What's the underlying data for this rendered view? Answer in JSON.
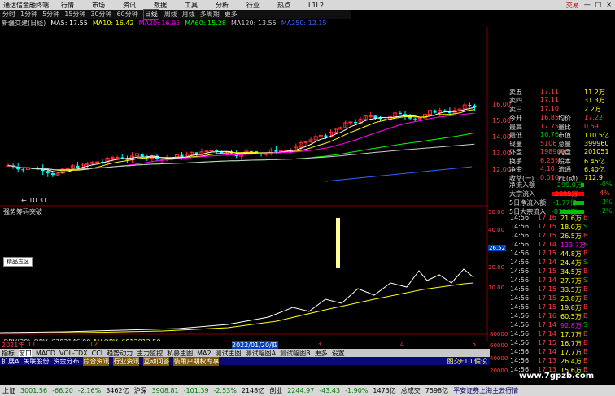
{
  "menu": {
    "app_title": "通达信金融终端",
    "items": [
      "行情",
      "市场",
      "资讯",
      "数据",
      "工具",
      "分析",
      "行业",
      "热点",
      "L1L2"
    ],
    "right": [
      "交易",
      "—",
      "□",
      "×"
    ]
  },
  "periods": {
    "items": [
      "分时",
      "1分钟",
      "5分钟",
      "15分钟",
      "30分钟",
      "60分钟",
      "日线",
      "周线",
      "月线",
      "多周期",
      "更多"
    ],
    "active_index": 6
  },
  "ma_line": {
    "title": "新疆交建(日线)",
    "items": [
      {
        "text": "MA5: 17.55",
        "color": "#ffffff"
      },
      {
        "text": "MA10: 16.42",
        "color": "#ffff00"
      },
      {
        "text": "MA20: 16.95",
        "color": "#ff00ff"
      },
      {
        "text": "MA60: 15.28",
        "color": "#00ff00"
      },
      {
        "text": "MA120: 13.55",
        "color": "#cccccc"
      },
      {
        "text": "MA250: 12.15",
        "color": "#3366ff"
      }
    ]
  },
  "price_axis": [
    "16.00",
    "15.00",
    "14.00",
    "13.00",
    "12.00"
  ],
  "low_label": "10.31",
  "indicator1": {
    "title": "强势筹码突破",
    "box_label": "精品五区",
    "axis": [
      "50.00",
      "40.00",
      "26.52",
      "20.00",
      "10.00"
    ]
  },
  "indicator2": {
    "title": "OBV(30)",
    "obv": "OBV: 6782146.00",
    "maobv": "MAOBV: 6812012.50",
    "axis": [
      "80000",
      "60000",
      "40000",
      "20000"
    ]
  },
  "date_axis": {
    "labels": [
      "2021年",
      "11",
      "12",
      "2022/01/20/四",
      "3",
      "4",
      "5"
    ]
  },
  "order_book": [
    {
      "label": "卖四",
      "price": "17.11",
      "vol": "31.3万"
    },
    {
      "label": "卖三",
      "price": "17.10",
      "vol": "2.2万"
    }
  ],
  "order_book_top": {
    "label": "卖五",
    "price": "17.11",
    "vol": "11.2万"
  },
  "stats": [
    {
      "l1": "今开",
      "v1": "16.85",
      "l2": "均价",
      "v2": "17.22"
    },
    {
      "l1": "最高",
      "v1": "17.75",
      "l2": "量比",
      "v2": "0.59"
    },
    {
      "l1": "最低",
      "v1": "16.76",
      "l2": "市值",
      "v2": "110.5亿"
    },
    {
      "l1": "现量",
      "v1": "5106",
      "l2": "总量",
      "v2": "399960"
    },
    {
      "l1": "外盘",
      "v1": "198909",
      "l2": "内盘",
      "v2": "201051"
    },
    {
      "l1": "换手",
      "v1": "6.25%",
      "l2": "股本",
      "v2": "6.45亿"
    },
    {
      "l1": "净资",
      "v1": "4.10",
      "l2": "流通",
      "v2": "6.40亿"
    },
    {
      "l1": "收益(一)",
      "v1": "0.010",
      "l2": "PE(动)",
      "v2": "712.9"
    }
  ],
  "fund_flow": [
    {
      "label": "净流入额",
      "value": "-299.0万",
      "pct": "-0%"
    },
    {
      "label": "大宗流入",
      "value": "2695万",
      "pct": "4%"
    },
    {
      "label": "5日净流入额",
      "value": "-1.77亿",
      "pct": "-3%"
    },
    {
      "label": "5日大宗流入",
      "value": "-8326万",
      "pct": "-2%"
    }
  ],
  "ticks": [
    {
      "t": "14:56",
      "p": "17.16",
      "v": "21.6",
      "d": "B"
    },
    {
      "t": "14:56",
      "p": "17.15",
      "v": "18.0",
      "d": "S"
    },
    {
      "t": "14:56",
      "p": "17.15",
      "v": "26.5",
      "d": "B"
    },
    {
      "t": "14:56",
      "p": "17.14",
      "v": "133.7",
      "d": "S"
    },
    {
      "t": "14:56",
      "p": "17.15",
      "v": "44.8",
      "d": "B"
    },
    {
      "t": "14:56",
      "p": "17.14",
      "v": "24.4",
      "d": "S"
    },
    {
      "t": "14:56",
      "p": "17.15",
      "v": "34.5",
      "d": "B"
    },
    {
      "t": "14:56",
      "p": "17.14",
      "v": "27.7",
      "d": "S"
    },
    {
      "t": "14:56",
      "p": "17.15",
      "v": "33.5",
      "d": "B"
    },
    {
      "t": "14:56",
      "p": "17.15",
      "v": "23.8",
      "d": "B"
    },
    {
      "t": "14:56",
      "p": "17.15",
      "v": "19.8",
      "d": "B"
    },
    {
      "t": "14:56",
      "p": "17.16",
      "v": "60.5",
      "d": "B"
    },
    {
      "t": "14:56",
      "p": "17.14",
      "v": "92.8",
      "d": "S"
    },
    {
      "t": "14:56",
      "p": "17.14",
      "v": "17.7",
      "d": "B"
    },
    {
      "t": "14:56",
      "p": "17.15",
      "v": "16.7",
      "d": "B"
    },
    {
      "t": "14:56",
      "p": "17.14",
      "v": "17.7",
      "d": "B"
    },
    {
      "t": "14:56",
      "p": "17.13",
      "v": "26.4",
      "d": "B"
    },
    {
      "t": "14:56",
      "p": "17.13",
      "v": "15.6",
      "d": "B"
    }
  ],
  "bottom_tabs": [
    "指标",
    "窗口",
    "MACD",
    "VOL-TDX",
    "CCI",
    "趋势动力",
    "主力监控",
    "私募主图",
    "MA2",
    "测试主图",
    "测试幅图A",
    "测试幅图B",
    "更多",
    "设置"
  ],
  "bottom_tabs2": [
    "扩展A",
    "关联股份",
    "资金分布",
    "综合资讯",
    "行业资讯",
    "互动问答",
    "装用户期权专享"
  ],
  "bottom_tabs2_right": "图交F10 假设",
  "status": [
    {
      "name": "上证",
      "value": "3001.56",
      "chg": "-66.20",
      "pct": "-2.16%",
      "amt": "3462亿"
    },
    {
      "name": "沪深",
      "value": "3908.81",
      "chg": "-101.39",
      "pct": "-2.53%",
      "amt": "2148亿"
    },
    {
      "name": "创业",
      "value": "2244.97",
      "chg": "-43.43",
      "pct": "-1.90%",
      "amt": "1473亿"
    }
  ],
  "status_extra": [
    "总成交",
    "7598亿",
    "平安证券上海主云行情"
  ],
  "watermark": "www.7gpzb.com",
  "colors": {
    "up": "#ff3030",
    "down": "#00ffff",
    "ma5": "#ffffff",
    "ma10": "#ffff00",
    "ma20": "#ff00ff",
    "ma60": "#00ff00",
    "ma120": "#cccccc",
    "ma250": "#3366ff"
  }
}
